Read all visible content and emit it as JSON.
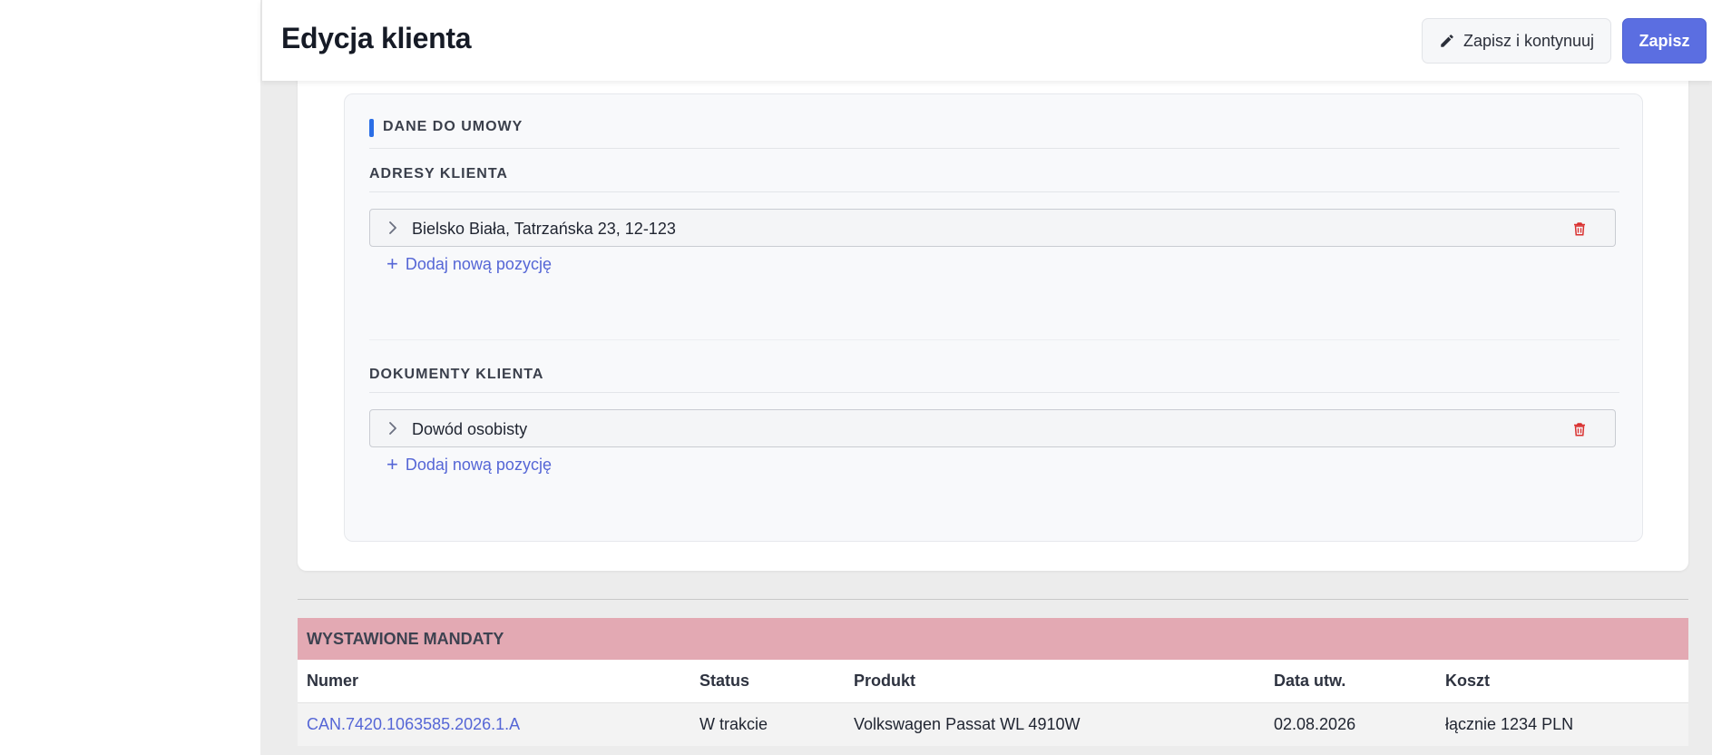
{
  "header": {
    "title": "Edycja klienta",
    "save_continue_label": "Zapisz i kontynuuj",
    "save_label": "Zapisz"
  },
  "contract_section": {
    "title": "DANE DO UMOWY",
    "addresses": {
      "title": "ADRESY KLIENTA",
      "items": [
        "Bielsko Biała, Tatrzańska 23, 12-123"
      ],
      "add_label": "Dodaj nową pozycję"
    },
    "documents": {
      "title": "DOKUMENTY KLIENTA",
      "items": [
        "Dowód osobisty"
      ],
      "add_label": "Dodaj nową pozycję"
    }
  },
  "mandates": {
    "title": "WYSTAWIONE MANDATY",
    "columns": [
      "Numer",
      "Status",
      "Produkt",
      "Data utw.",
      "Koszt"
    ],
    "rows": [
      [
        "CAN.7420.1063585.2026.1.A",
        "W trakcie",
        "Volkswagen Passat WL 4910W",
        "02.08.2026",
        "łącznie 1234 PLN"
      ]
    ]
  },
  "colors": {
    "primary": "#5b6ee1",
    "link": "#5566d6",
    "accent_bar": "#2b6ee6",
    "delete_icon": "#d9302f",
    "mandates_header_bg": "#e3a9b3"
  },
  "icons": {
    "edit": "pencil-icon",
    "expand": "chevron-right-icon",
    "delete": "trash-icon",
    "add": "plus-icon"
  }
}
